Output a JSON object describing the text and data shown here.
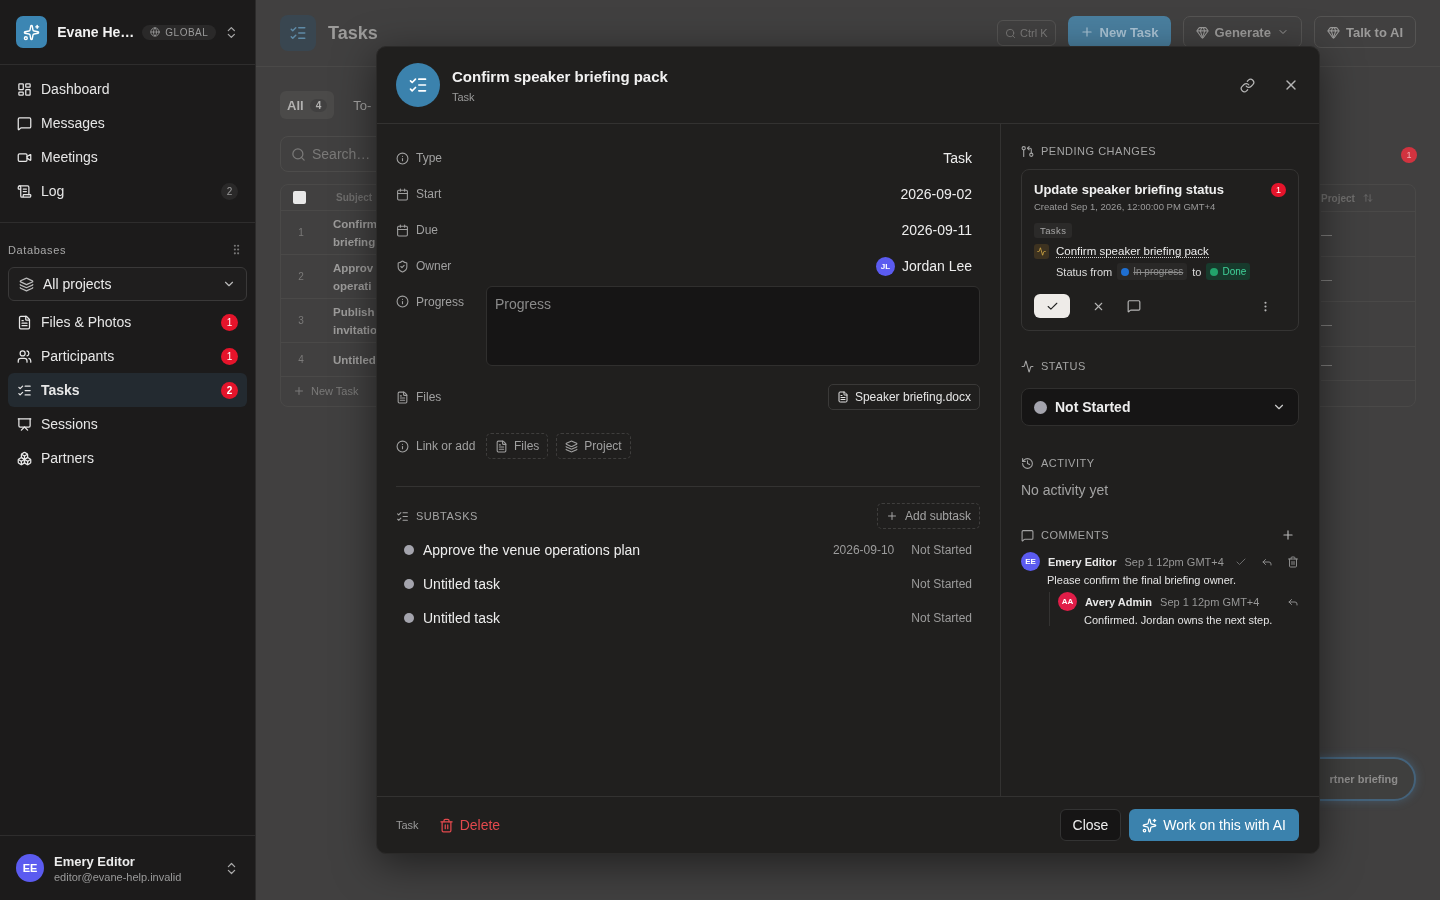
{
  "sidebar": {
    "workspace": "Evane He…",
    "scope": "GLOBAL",
    "nav": [
      {
        "label": "Dashboard",
        "selected": false
      },
      {
        "label": "Messages",
        "selected": false
      },
      {
        "label": "Meetings",
        "selected": false
      },
      {
        "label": "Log",
        "badge": "2",
        "alert": false,
        "selected": false
      }
    ],
    "databases_title": "Databases",
    "project_select": "All projects",
    "db_items": [
      {
        "label": "Files & Photos",
        "badge": "1",
        "alert": true,
        "selected": false
      },
      {
        "label": "Participants",
        "badge": "1",
        "alert": true,
        "selected": false
      },
      {
        "label": "Tasks",
        "badge": "2",
        "alert": true,
        "selected": true
      },
      {
        "label": "Sessions",
        "selected": false
      },
      {
        "label": "Partners",
        "selected": false
      }
    ],
    "user": {
      "initials": "EE",
      "name": "Emery Editor",
      "email": "editor@evane-help.invalid"
    }
  },
  "page": {
    "title": "Tasks",
    "search_shortcut": "Ctrl K",
    "buttons": [
      {
        "label": "New Task",
        "kind": "primary"
      },
      {
        "label": "Generate",
        "kind": "menu"
      },
      {
        "label": "Talk to AI",
        "kind": "plain"
      }
    ],
    "tabs": [
      {
        "label": "All",
        "count": "4",
        "selected": true
      },
      {
        "label": "To-",
        "selected": false
      }
    ],
    "search_placeholder": "Search…",
    "table": {
      "select_all": {
        "checked": false
      },
      "columns": [
        "Subject",
        "Project"
      ],
      "rows": [
        {
          "number": "1",
          "subject": [
            "Confirm",
            "briefing"
          ],
          "project": "—"
        },
        {
          "number": "2",
          "subject": [
            "Approv",
            "operati"
          ],
          "project": "—"
        },
        {
          "number": "3",
          "subject": [
            "Publish",
            "invitatio"
          ],
          "project": "—"
        },
        {
          "number": "4",
          "subject": [
            "Untitled"
          ],
          "project": "—"
        }
      ],
      "new_row": "New Task"
    },
    "alert_badge": "1",
    "floating_button": "rtner briefing"
  },
  "modal": {
    "title": "Confirm speaker briefing pack",
    "subtitle": "Task",
    "fields": [
      {
        "kind": "text",
        "label": "Type",
        "value": "Task"
      },
      {
        "kind": "date",
        "label": "Start",
        "value": "2026-09-02"
      },
      {
        "kind": "date",
        "label": "Due",
        "value": "2026-09-11"
      },
      {
        "kind": "person",
        "label": "Owner",
        "initials": "JL",
        "value": "Jordan Lee"
      },
      {
        "kind": "textarea",
        "label": "Progress",
        "placeholder": "Progress"
      },
      {
        "kind": "files",
        "label": "Files",
        "files": [
          "Speaker briefing.docx"
        ]
      },
      {
        "kind": "links",
        "label": "Link or add",
        "links": [
          "Files",
          "Project"
        ]
      }
    ],
    "subtasks": {
      "title": "SUBTASKS",
      "add": "Add subtask",
      "items": [
        {
          "title": "Approve the venue operations plan",
          "date": "2026-09-10",
          "status": "Not Started"
        },
        {
          "title": "Untitled task",
          "status": "Not Started"
        },
        {
          "title": "Untitled task",
          "status": "Not Started"
        }
      ]
    },
    "pending": {
      "title": "PENDING CHANGES",
      "card": {
        "title": "Update speaker briefing status",
        "badge": "1",
        "created": "Created Sep 1, 2026, 12:00:00 PM GMT+4",
        "tag": "Tasks",
        "record": "Confirm speaker briefing pack",
        "status_label": "Status from",
        "from": {
          "label": "In progress",
          "color": "#1f6fd1"
        },
        "to_word": "to",
        "to": {
          "label": "Done",
          "color": "#22a36b"
        }
      }
    },
    "status": {
      "title": "STATUS",
      "value": "Not Started"
    },
    "activity": {
      "title": "ACTIVITY",
      "empty": "No activity yet"
    },
    "comments": {
      "title": "COMMENTS",
      "items": [
        {
          "initials": "EE",
          "color": "#5b5bf0",
          "author": "Emery Editor",
          "time": "Sep 1 12pm GMT+4",
          "text": "Please confirm the final briefing owner.",
          "resolvable": true,
          "deletable": true,
          "children": [
            {
              "initials": "AA",
              "color": "#e11d48",
              "author": "Avery Admin",
              "time": "Sep 1 12pm GMT+4",
              "text": "Confirmed. Jordan owns the next step."
            }
          ]
        }
      ]
    },
    "footer": {
      "type": "Task",
      "delete": "Delete",
      "close": "Close",
      "ai": "Work on this with AI"
    }
  }
}
